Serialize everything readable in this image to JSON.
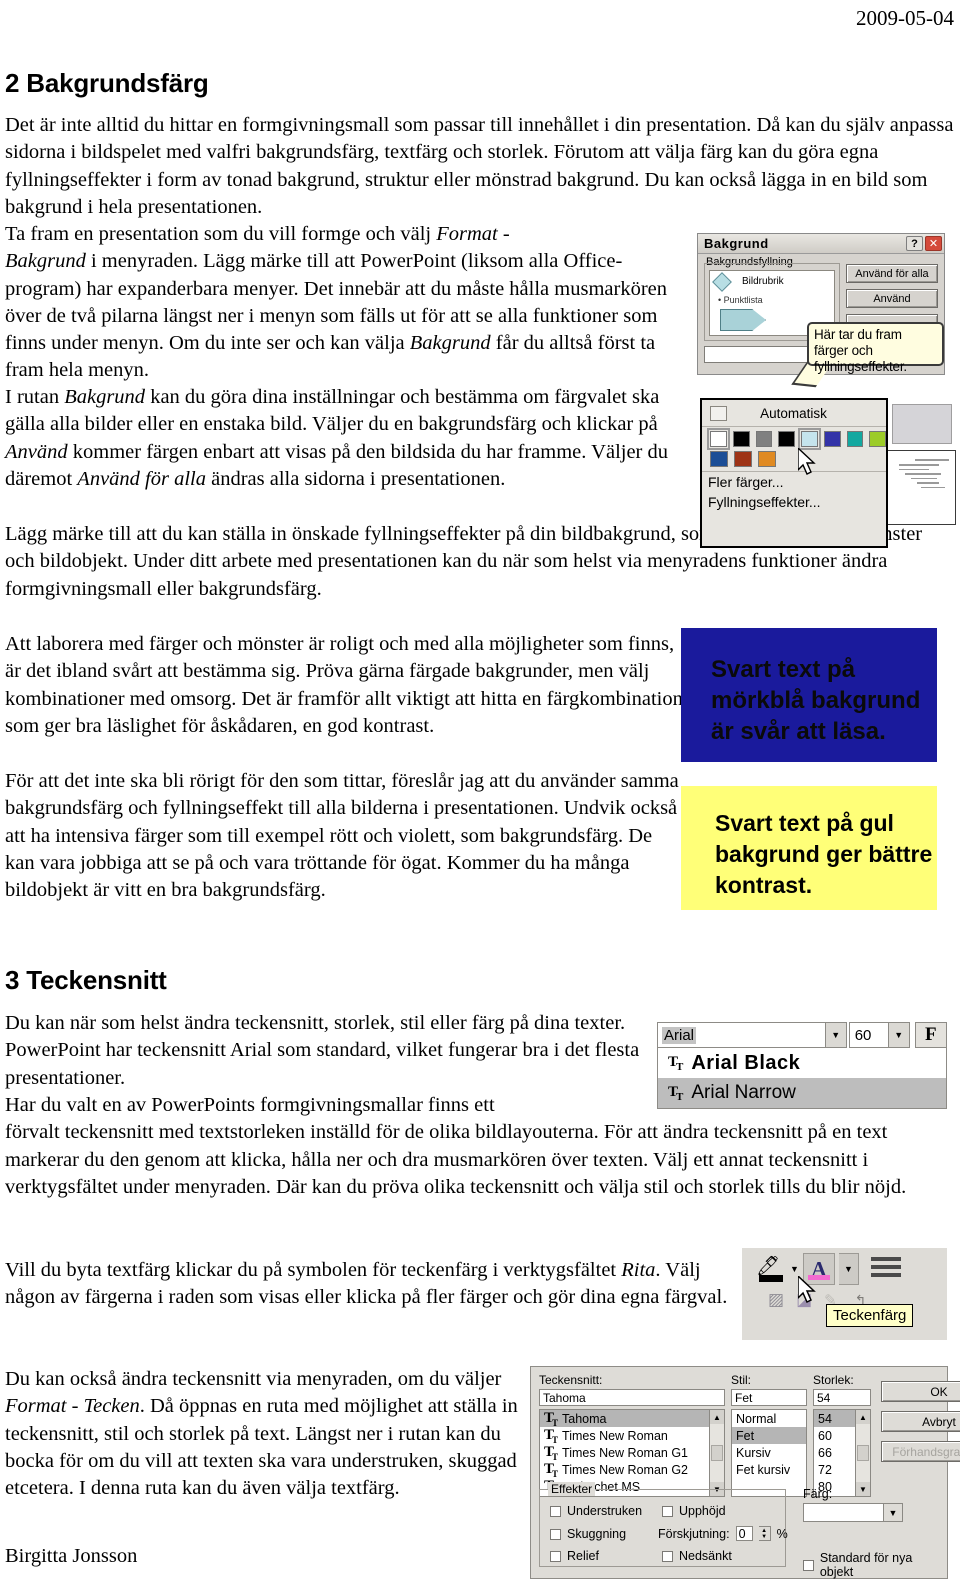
{
  "header": {
    "date": "2009-05-04"
  },
  "sections": [
    {
      "heading": "2 Bakgrundsfärg",
      "paragraphs": [
        "Det är inte alltid du hittar en formgivningsmall som passar till innehållet i din presentation. Då kan du själv anpassa sidorna i bildspelet med valfri bakgrundsfärg, textfärg och storlek. Förutom att välja färg kan du göra egna fyllningseffekter i form av tonad bakgrund, struktur eller mönstrad bakgrund. Du kan också lägga in en bild som bakgrund i hela presentationen.",
        "Ta fram en presentation som du vill formge och välj Format - Bakgrund i menyraden. Lägg märke till att PowerPoint (liksom alla Office-program) har expanderbara menyer. Det innebär att du måste hålla musmarkören över de två pilarna längst ner i menyn som fälls ut för att se alla funktioner som finns under menyn. Om du inte ser och kan välja Bakgrund får du alltså först ta fram hela menyn.",
        "I rutan Bakgrund kan du göra dina inställningar och bestämma om färgvalet ska gälla alla bilder eller en enstaka bild. Väljer du en bakgrundsfärg och klickar på Använd kommer färgen enbart att visas på den bildsida du har framme. Väljer du däremot Använd för alla ändras alla sidorna i presentationen.",
        "Lägg märke till att du kan ställa in önskade fyllningseffekter på din bildbakgrund, som toning, struktur, mönster och bildobjekt. Under ditt arbete med presentationen kan du när som helst via menyradens funktioner ändra formgivningsmall eller bakgrundsfärg.",
        "Att laborera med färger och mönster är roligt och med alla möjligheter som finns, är det ibland svårt att bestämma sig. Pröva gärna färgade bakgrunder, men välj kombinationer med omsorg. Det är framför allt viktigt att hitta en färgkombination som ger bra läslighet för åskådaren, en god kontrast.",
        "För att det inte ska bli rörigt för den som tittar, föreslår jag att du använder samma bakgrundsfärg och fyllningseffekt till alla bilderna i presentationen. Undvik också att ha intensiva färger som till exempel rött och violett, som bakgrundsfärg. De kan vara jobbiga att se på och vara tröttande för ögat. Kommer du ha många bildobjekt är vitt en bra bakgrundsfärg."
      ]
    },
    {
      "heading": "3 Teckensnitt",
      "paragraphs": [
        "Du kan när som helst ändra teckensnitt, storlek, stil eller färg på dina texter. PowerPoint har teckensnitt Arial som standard, vilket fungerar bra i det flesta presentationer.",
        "Har du valt en av PowerPoints formgivningsmallar finns ett förvalt teckensnitt med textstorleken inställd för de olika bildlayouterna. För att ändra teckensnitt på en text markerar du den genom att klicka, hålla ner och dra musmarkören över texten. Välj ett annat teckensnitt i verktygsfältet under menyraden. Där kan du pröva olika teckensnitt och välja stil och storlek tills du blir nöjd.",
        "Vill du byta textfärg klickar du på symbolen för teckenfärg i verktygsfältet Rita. Välj någon av färgerna i raden som visas eller klicka på fler färger och gör dina egna färgval.",
        "Du kan också ändra teckensnitt via menyraden, om du väljer Format - Tecken. Då öppnas en ruta med möjlighet att ställa in teckensnitt, stil och storlek på text. Längst ner i rutan kan du bocka för om du vill att texten ska vara understruken, skuggad etcetera. I denna ruta kan du även välja textfärg."
      ]
    }
  ],
  "footer": {
    "author": "Birgitta Jonsson"
  },
  "bakgrund_dialog": {
    "title": "Bakgrund",
    "help_btn": "?",
    "close_btn": "✕",
    "group_label": "Bakgrundsfyllning",
    "preview": {
      "title": "Bildrubrik",
      "bullet": "• Punktlista"
    },
    "buttons": [
      "Använd för alla",
      "Använd",
      "",
      ""
    ],
    "combo_value": ""
  },
  "callout": {
    "text": "Här tar du fram färger och fyllningseffekter."
  },
  "color_dropdown": {
    "automatic_label": "Automatisk",
    "row1": [
      "#ffffff",
      "#000000",
      "#808080",
      "#000000",
      "#c5e4ec",
      "#3333a8",
      "#13a8a0",
      "#9ccc28"
    ],
    "row1_selected_index": 4,
    "row2": [
      "#1c4e96",
      "#9e3316",
      "#e08a22"
    ],
    "items": [
      "Fler färger...",
      "Fyllningseffekter..."
    ]
  },
  "slide_blue": {
    "text": "Svart text på mörkblå bakgrund är svår att läsa.",
    "bg": "#1a1a9c",
    "fg": "#0a0a0a"
  },
  "slide_yellow": {
    "text": "Svart text på gul bakgrund ger bättre kontrast.",
    "bg": "#ffff78",
    "fg": "#000000"
  },
  "font_toolbar": {
    "font_name": "Arial",
    "font_size": "60",
    "bold_label": "F",
    "dropdown_items": [
      {
        "icon": "truetype-icon",
        "label": "Arial Black",
        "selected": false
      },
      {
        "icon": "truetype-icon",
        "label": "Arial Narrow",
        "selected": true
      }
    ]
  },
  "color_toolbar": {
    "tooltip": "Teckenfärg",
    "highlight_icon": "highlight-pen-icon",
    "font_color_icon": "font-color-A-icon",
    "lines_icon": "line-style-icon"
  },
  "tecken_dialog": {
    "font_label": "Teckensnitt:",
    "font_value": "Tahoma",
    "font_list": [
      "Tahoma",
      "Times New Roman",
      "Times New Roman G1",
      "Times New Roman G2",
      "Trebuchet MS"
    ],
    "font_selected": "Tahoma",
    "style_label": "Stil:",
    "style_value": "Fet",
    "style_list": [
      "Normal",
      "Fet",
      "Kursiv",
      "Fet kursiv"
    ],
    "style_selected": "Fet",
    "size_label": "Storlek:",
    "size_value": "54",
    "size_list": [
      "54",
      "60",
      "66",
      "72",
      "80"
    ],
    "size_selected": "54",
    "buttons": [
      "OK",
      "Avbryt",
      "Förhandsgranska"
    ],
    "effects_label": "Effekter",
    "effects": [
      "Understruken",
      "Skuggning",
      "Relief",
      "Upphöjd",
      "Nedsänkt"
    ],
    "offset_label": "Förskjutning:",
    "offset_value": "0",
    "offset_unit": "%",
    "color_label": "Färg:",
    "color_value": "",
    "standard_label": "Standard för nya objekt"
  }
}
